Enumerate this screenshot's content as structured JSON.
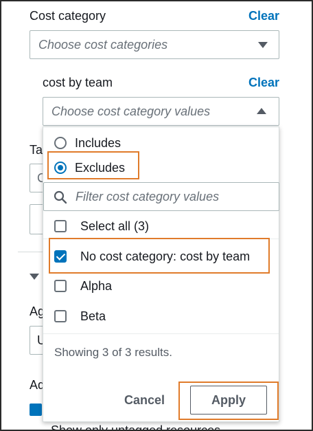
{
  "cost_category": {
    "label": "Cost category",
    "clear": "Clear",
    "placeholder": "Choose cost categories"
  },
  "cost_by_team": {
    "label": "cost by team",
    "clear": "Clear",
    "placeholder": "Choose cost category values"
  },
  "background": {
    "partial_label_1": "Ta",
    "partial_text_2": "C",
    "partial_label_3": "Ag",
    "partial_text_4": "U",
    "partial_label_5": "Ad",
    "partial_bottom": "Show only untagged resources"
  },
  "dropdown": {
    "radio_includes": "Includes",
    "radio_excludes": "Excludes",
    "selected_mode": "Excludes",
    "filter_placeholder": "Filter cost category values",
    "options": [
      {
        "label": "Select all (3)",
        "checked": false
      },
      {
        "label": "No cost category: cost by team",
        "checked": true
      },
      {
        "label": "Alpha",
        "checked": false
      },
      {
        "label": "Beta",
        "checked": false
      }
    ],
    "showing": "Showing 3 of 3 results.",
    "cancel": "Cancel",
    "apply": "Apply"
  },
  "colors": {
    "link": "#0073bb",
    "highlight": "#e07b2a",
    "checked": "#0073bb"
  }
}
